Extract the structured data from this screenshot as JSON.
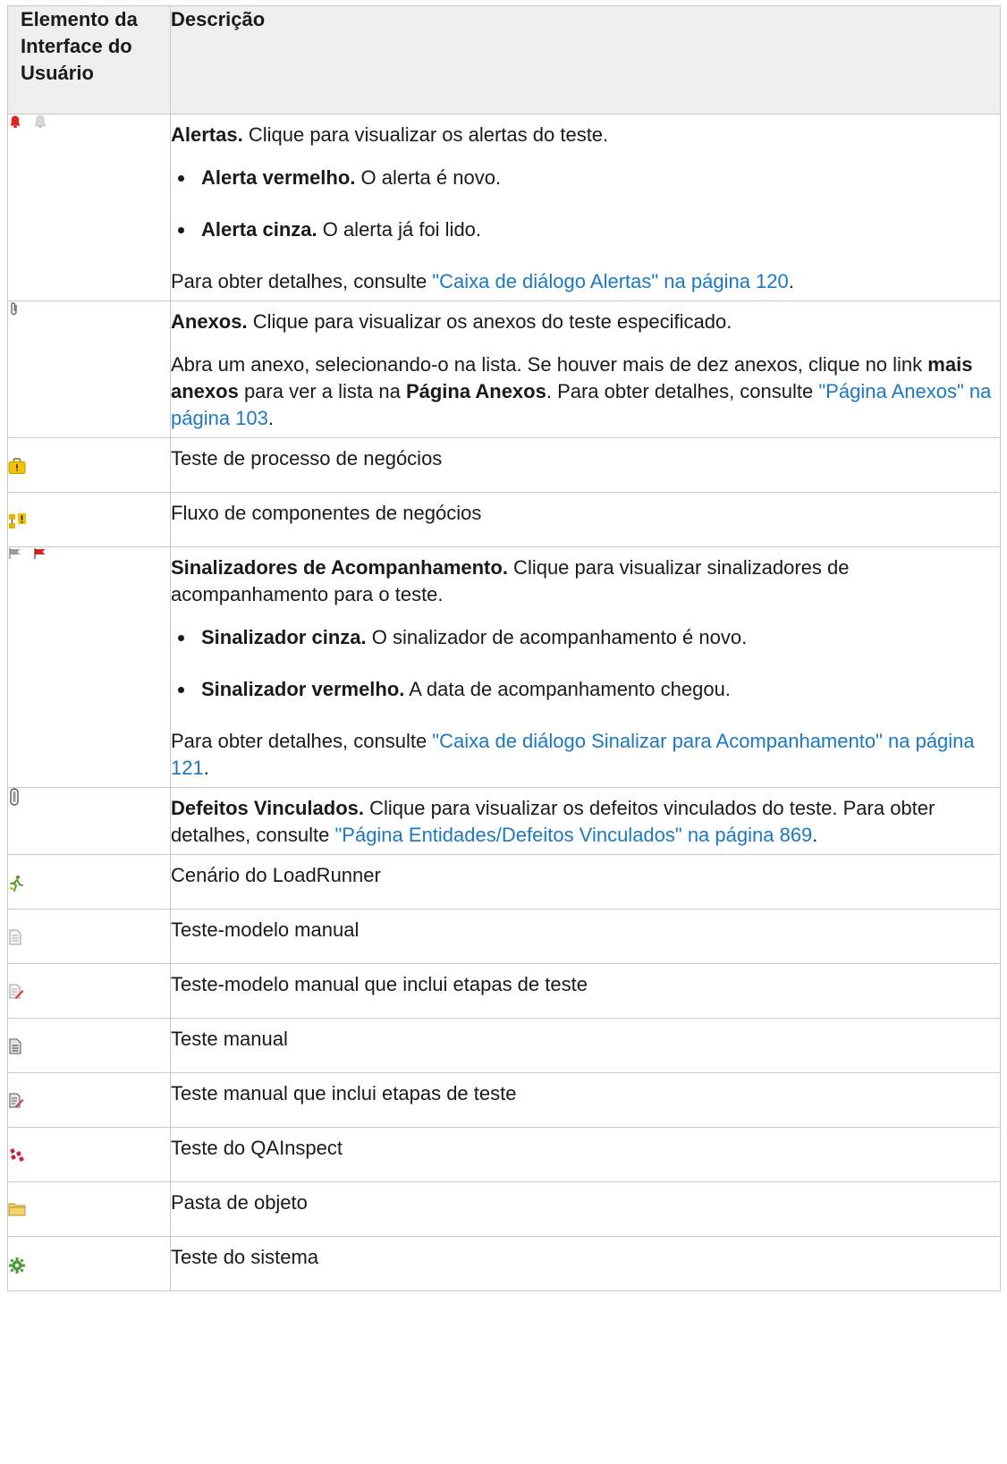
{
  "header": {
    "col1": "Elemento da Interface do Usuário",
    "col2": "Descrição"
  },
  "rows": {
    "alerts": {
      "title": "Alertas.",
      "text": " Clique para visualizar os alertas do teste.",
      "bullets": [
        {
          "title": "Alerta vermelho.",
          "text": " O alerta é novo."
        },
        {
          "title": "Alerta cinza.",
          "text": " O alerta já foi lido."
        }
      ],
      "details_prefix": "Para obter detalhes, consulte ",
      "details_link": "\"Caixa de diálogo Alertas\" na página 120",
      "details_suffix": ".",
      "icons": [
        "red-alert-bell-icon",
        "gray-alert-bell-icon"
      ]
    },
    "attachments": {
      "title": "Anexos.",
      "text": " Clique para visualizar os anexos do teste especificado.",
      "p2_a": "Abra um anexo, selecionando-o na lista. Se houver mais de dez anexos, clique no link ",
      "p2_bold1": "mais anexos",
      "p2_b": " para ver a lista na ",
      "p2_bold2": "Página Anexos",
      "p2_c": ". Para obter detalhes, consulte ",
      "p2_link": "\"Página Anexos\" na página 103",
      "p2_d": ".",
      "icon": "paperclip-icon"
    },
    "business_process": {
      "text": "Teste de processo de negócios",
      "icon": "business-process-test-icon"
    },
    "business_flow": {
      "text": "Fluxo de componentes de negócios",
      "icon": "business-flow-icon"
    },
    "flags": {
      "title": "Sinalizadores de Acompanhamento.",
      "text": " Clique para visualizar sinalizadores de acompanhamento para o teste.",
      "bullets": [
        {
          "title": "Sinalizador cinza.",
          "text": " O sinalizador de acompanhamento é novo."
        },
        {
          "title": "Sinalizador vermelho.",
          "text": " A data de acompanhamento chegou."
        }
      ],
      "details_prefix": "Para obter detalhes, consulte ",
      "details_link": "\"Caixa de diálogo Sinalizar para Acompanhamento\" na página 121",
      "details_suffix": ".",
      "icons": [
        "gray-flag-icon",
        "red-flag-icon"
      ]
    },
    "linked_defects": {
      "title": "Defeitos Vinculados.",
      "text": " Clique para visualizar os defeitos vinculados do teste. Para obter detalhes, consulte ",
      "link": "\"Página Entidades/Defeitos Vinculados\" na página 869",
      "suffix": ".",
      "icon": "linked-defects-icon"
    },
    "loadrunner": {
      "text": "Cenário do LoadRunner",
      "icon": "loadrunner-scenario-icon"
    },
    "manual_template": {
      "text": "Teste-modelo manual",
      "icon": "manual-template-icon"
    },
    "manual_template_steps": {
      "text": "Teste-modelo manual que inclui etapas de teste",
      "icon": "manual-template-steps-icon"
    },
    "manual": {
      "text": "Teste manual",
      "icon": "manual-test-icon"
    },
    "manual_steps": {
      "text": "Teste manual que inclui etapas de teste",
      "icon": "manual-test-steps-icon"
    },
    "qainspect": {
      "text": "Teste do QAInspect",
      "icon": "qainspect-test-icon"
    },
    "folder": {
      "text": "Pasta de objeto",
      "icon": "folder-icon"
    },
    "system": {
      "text": "Teste do sistema",
      "icon": "system-test-icon"
    }
  },
  "colors": {
    "link": "#1b78c5",
    "border": "#c9c9c9",
    "header_bg": "#efefef"
  }
}
